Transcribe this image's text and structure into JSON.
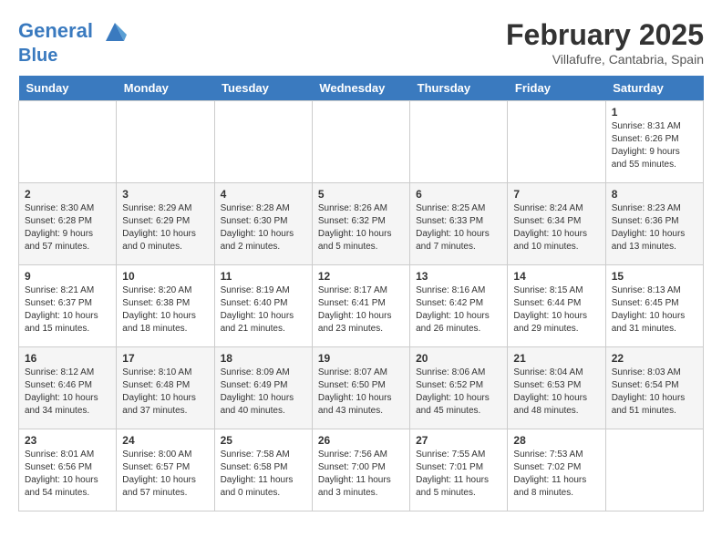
{
  "header": {
    "logo_line1": "General",
    "logo_line2": "Blue",
    "month_year": "February 2025",
    "location": "Villafufre, Cantabria, Spain"
  },
  "days_of_week": [
    "Sunday",
    "Monday",
    "Tuesday",
    "Wednesday",
    "Thursday",
    "Friday",
    "Saturday"
  ],
  "weeks": [
    [
      {
        "day": "",
        "info": ""
      },
      {
        "day": "",
        "info": ""
      },
      {
        "day": "",
        "info": ""
      },
      {
        "day": "",
        "info": ""
      },
      {
        "day": "",
        "info": ""
      },
      {
        "day": "",
        "info": ""
      },
      {
        "day": "1",
        "info": "Sunrise: 8:31 AM\nSunset: 6:26 PM\nDaylight: 9 hours and 55 minutes."
      }
    ],
    [
      {
        "day": "2",
        "info": "Sunrise: 8:30 AM\nSunset: 6:28 PM\nDaylight: 9 hours and 57 minutes."
      },
      {
        "day": "3",
        "info": "Sunrise: 8:29 AM\nSunset: 6:29 PM\nDaylight: 10 hours and 0 minutes."
      },
      {
        "day": "4",
        "info": "Sunrise: 8:28 AM\nSunset: 6:30 PM\nDaylight: 10 hours and 2 minutes."
      },
      {
        "day": "5",
        "info": "Sunrise: 8:26 AM\nSunset: 6:32 PM\nDaylight: 10 hours and 5 minutes."
      },
      {
        "day": "6",
        "info": "Sunrise: 8:25 AM\nSunset: 6:33 PM\nDaylight: 10 hours and 7 minutes."
      },
      {
        "day": "7",
        "info": "Sunrise: 8:24 AM\nSunset: 6:34 PM\nDaylight: 10 hours and 10 minutes."
      },
      {
        "day": "8",
        "info": "Sunrise: 8:23 AM\nSunset: 6:36 PM\nDaylight: 10 hours and 13 minutes."
      }
    ],
    [
      {
        "day": "9",
        "info": "Sunrise: 8:21 AM\nSunset: 6:37 PM\nDaylight: 10 hours and 15 minutes."
      },
      {
        "day": "10",
        "info": "Sunrise: 8:20 AM\nSunset: 6:38 PM\nDaylight: 10 hours and 18 minutes."
      },
      {
        "day": "11",
        "info": "Sunrise: 8:19 AM\nSunset: 6:40 PM\nDaylight: 10 hours and 21 minutes."
      },
      {
        "day": "12",
        "info": "Sunrise: 8:17 AM\nSunset: 6:41 PM\nDaylight: 10 hours and 23 minutes."
      },
      {
        "day": "13",
        "info": "Sunrise: 8:16 AM\nSunset: 6:42 PM\nDaylight: 10 hours and 26 minutes."
      },
      {
        "day": "14",
        "info": "Sunrise: 8:15 AM\nSunset: 6:44 PM\nDaylight: 10 hours and 29 minutes."
      },
      {
        "day": "15",
        "info": "Sunrise: 8:13 AM\nSunset: 6:45 PM\nDaylight: 10 hours and 31 minutes."
      }
    ],
    [
      {
        "day": "16",
        "info": "Sunrise: 8:12 AM\nSunset: 6:46 PM\nDaylight: 10 hours and 34 minutes."
      },
      {
        "day": "17",
        "info": "Sunrise: 8:10 AM\nSunset: 6:48 PM\nDaylight: 10 hours and 37 minutes."
      },
      {
        "day": "18",
        "info": "Sunrise: 8:09 AM\nSunset: 6:49 PM\nDaylight: 10 hours and 40 minutes."
      },
      {
        "day": "19",
        "info": "Sunrise: 8:07 AM\nSunset: 6:50 PM\nDaylight: 10 hours and 43 minutes."
      },
      {
        "day": "20",
        "info": "Sunrise: 8:06 AM\nSunset: 6:52 PM\nDaylight: 10 hours and 45 minutes."
      },
      {
        "day": "21",
        "info": "Sunrise: 8:04 AM\nSunset: 6:53 PM\nDaylight: 10 hours and 48 minutes."
      },
      {
        "day": "22",
        "info": "Sunrise: 8:03 AM\nSunset: 6:54 PM\nDaylight: 10 hours and 51 minutes."
      }
    ],
    [
      {
        "day": "23",
        "info": "Sunrise: 8:01 AM\nSunset: 6:56 PM\nDaylight: 10 hours and 54 minutes."
      },
      {
        "day": "24",
        "info": "Sunrise: 8:00 AM\nSunset: 6:57 PM\nDaylight: 10 hours and 57 minutes."
      },
      {
        "day": "25",
        "info": "Sunrise: 7:58 AM\nSunset: 6:58 PM\nDaylight: 11 hours and 0 minutes."
      },
      {
        "day": "26",
        "info": "Sunrise: 7:56 AM\nSunset: 7:00 PM\nDaylight: 11 hours and 3 minutes."
      },
      {
        "day": "27",
        "info": "Sunrise: 7:55 AM\nSunset: 7:01 PM\nDaylight: 11 hours and 5 minutes."
      },
      {
        "day": "28",
        "info": "Sunrise: 7:53 AM\nSunset: 7:02 PM\nDaylight: 11 hours and 8 minutes."
      },
      {
        "day": "",
        "info": ""
      }
    ]
  ]
}
